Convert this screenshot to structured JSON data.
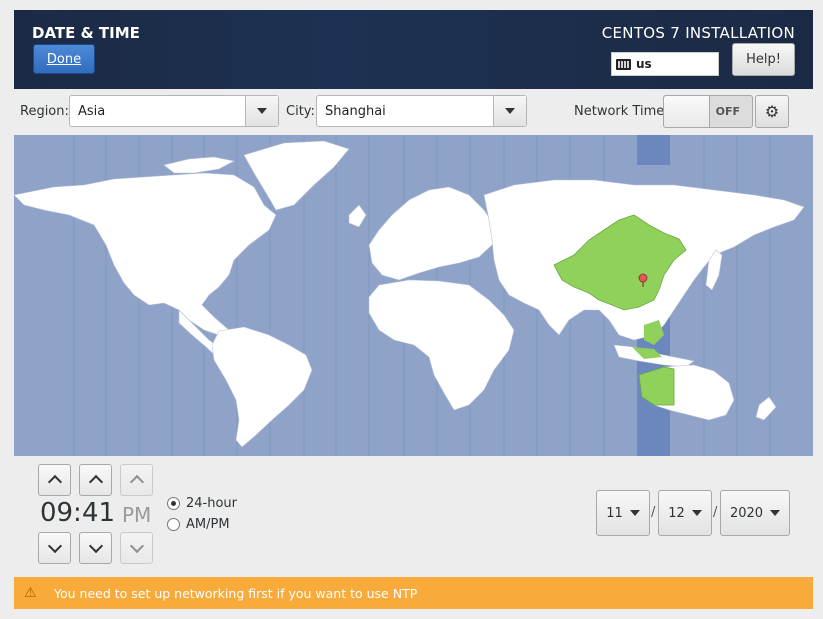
{
  "header": {
    "title": "DATE & TIME",
    "done_label": "Done",
    "product": "CENTOS 7 INSTALLATION",
    "keyboard_layout": "us",
    "help_label": "Help!"
  },
  "location": {
    "region_label": "Region:",
    "region_value": "Asia",
    "city_label": "City:",
    "city_value": "Shanghai"
  },
  "network_time": {
    "label": "Network Time",
    "state": "OFF"
  },
  "map": {
    "ocean_color": "#8fa3c9",
    "land_color": "#ffffff",
    "highlight_color": "#8fd15a",
    "timezone_band_color": "#6b87bd"
  },
  "time": {
    "hours": "09",
    "separator": ":",
    "minutes": "41",
    "ampm": "PM",
    "format_24": "24-hour",
    "format_ampm": "AM/PM",
    "selected_format": "24-hour"
  },
  "date": {
    "month": "11",
    "day": "12",
    "year": "2020",
    "separator": "/"
  },
  "warning": {
    "text": "You need to set up networking first if you want to use NTP",
    "color": "#f8ab3a"
  }
}
